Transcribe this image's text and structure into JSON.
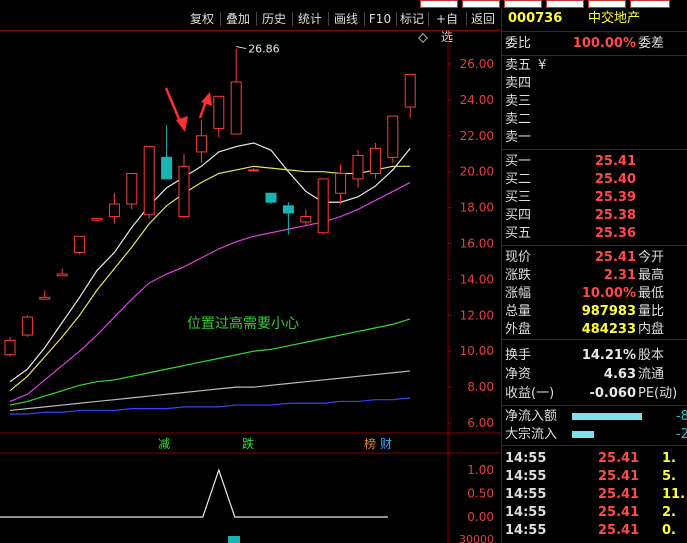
{
  "toolbar": {
    "items": [
      "复权",
      "叠加",
      "历史",
      "统计",
      "画线",
      "F10",
      "标记",
      "+自选",
      "返回"
    ]
  },
  "stock": {
    "code": "000736",
    "name": "中交地产"
  },
  "weibi": {
    "label": "委比",
    "value": "100.00%",
    "right": "委差"
  },
  "sell": [
    {
      "label": "卖五",
      "price": "¥"
    },
    {
      "label": "卖四",
      "price": ""
    },
    {
      "label": "卖三",
      "price": ""
    },
    {
      "label": "卖二",
      "price": ""
    },
    {
      "label": "卖一",
      "price": ""
    }
  ],
  "buy": [
    {
      "label": "买一",
      "price": "25.41"
    },
    {
      "label": "买二",
      "price": "25.40"
    },
    {
      "label": "买三",
      "price": "25.39"
    },
    {
      "label": "买四",
      "price": "25.38"
    },
    {
      "label": "买五",
      "price": "25.36"
    }
  ],
  "quote": [
    {
      "label": "现价",
      "value": "25.41",
      "right": "今开"
    },
    {
      "label": "涨跌",
      "value": "2.31",
      "right": "最高"
    },
    {
      "label": "涨幅",
      "value": "10.00%",
      "right": "最低"
    },
    {
      "label": "总量",
      "value": "987983",
      "right": "量比"
    },
    {
      "label": "外盘",
      "value": "484233",
      "right": "内盘"
    }
  ],
  "stats": [
    {
      "label": "换手",
      "value": "14.21%",
      "right": "股本"
    },
    {
      "label": "净资",
      "value": "4.63",
      "right": "流通"
    },
    {
      "label": "收益(一)",
      "value": "-0.060",
      "right": "PE(动)"
    }
  ],
  "flow": [
    {
      "label": "净流入额",
      "value": "-8"
    },
    {
      "label": "大宗流入",
      "value": "-2"
    }
  ],
  "ticks": [
    {
      "time": "14:55",
      "price": "25.41",
      "vol": "1."
    },
    {
      "time": "14:55",
      "price": "25.41",
      "vol": "5."
    },
    {
      "time": "14:55",
      "price": "25.41",
      "vol": "11."
    },
    {
      "time": "14:55",
      "price": "25.41",
      "vol": "2."
    },
    {
      "time": "14:55",
      "price": "25.41",
      "vol": "0."
    }
  ],
  "chart": {
    "peak_label": "26.86",
    "annotation": "位置过高需要小心",
    "markers": [
      "减",
      "跌",
      "榜",
      "财"
    ],
    "sub_axis": [
      "1.00",
      "0.50",
      "0.00"
    ],
    "bottom_axis": "30000"
  },
  "chart_data": {
    "type": "candlestick",
    "y_ticks": [
      26,
      24,
      22,
      20,
      18,
      16,
      14,
      12,
      10,
      8,
      6
    ],
    "y_tick_labels": [
      "26.00",
      "24.00",
      "22.00",
      "20.00",
      "18.00",
      "16.00",
      "14.00",
      "12.00",
      "10.00",
      "8.00",
      "6.00"
    ],
    "candles": [
      {
        "o": 9.8,
        "c": 10.6,
        "h": 10.8,
        "l": 9.7
      },
      {
        "o": 10.9,
        "c": 11.9,
        "h": 12.0,
        "l": 10.8
      },
      {
        "o": 12.9,
        "c": 13.0,
        "h": 13.4,
        "l": 12.9
      },
      {
        "o": 14.2,
        "c": 14.3,
        "h": 14.6,
        "l": 14.2
      },
      {
        "o": 15.5,
        "c": 16.4,
        "h": 16.4,
        "l": 15.4
      },
      {
        "o": 17.3,
        "c": 17.4,
        "h": 17.4,
        "l": 17.3
      },
      {
        "o": 17.5,
        "c": 18.2,
        "h": 18.8,
        "l": 17.1
      },
      {
        "o": 18.2,
        "c": 19.9,
        "h": 19.9,
        "l": 17.9
      },
      {
        "o": 17.6,
        "c": 21.4,
        "h": 21.4,
        "l": 17.4
      },
      {
        "o": 20.8,
        "c": 19.6,
        "h": 22.6,
        "l": 19.6
      },
      {
        "o": 17.5,
        "c": 20.3,
        "h": 21.0,
        "l": 17.4
      },
      {
        "o": 21.1,
        "c": 22.0,
        "h": 22.9,
        "l": 20.5
      },
      {
        "o": 22.4,
        "c": 24.2,
        "h": 24.2,
        "l": 21.9
      },
      {
        "o": 22.1,
        "c": 25.0,
        "h": 26.86,
        "l": 22.1
      },
      {
        "o": 20.1,
        "c": 20.1,
        "h": 20.2,
        "l": 20.0
      },
      {
        "o": 18.8,
        "c": 18.3,
        "h": 18.8,
        "l": 18.2
      },
      {
        "o": 18.1,
        "c": 17.7,
        "h": 18.3,
        "l": 16.5
      },
      {
        "o": 17.2,
        "c": 17.5,
        "h": 17.9,
        "l": 17.0
      },
      {
        "o": 16.6,
        "c": 19.6,
        "h": 19.6,
        "l": 16.5
      },
      {
        "o": 18.8,
        "c": 19.9,
        "h": 20.4,
        "l": 18.2
      },
      {
        "o": 19.6,
        "c": 20.9,
        "h": 21.2,
        "l": 19.1
      },
      {
        "o": 19.9,
        "c": 21.3,
        "h": 21.6,
        "l": 19.6
      },
      {
        "o": 20.8,
        "c": 23.1,
        "h": 23.1,
        "l": 20.5
      },
      {
        "o": 23.6,
        "c": 25.41,
        "h": 25.41,
        "l": 23.0
      }
    ],
    "ma_white": [
      8.3,
      9.0,
      10.2,
      11.6,
      13.0,
      14.5,
      15.5,
      16.9,
      18.1,
      19.1,
      19.7,
      20.3,
      21.1,
      21.4,
      21.6,
      21.2,
      20.0,
      18.9,
      18.3,
      18.3,
      18.6,
      19.2,
      20.1,
      21.3
    ],
    "ma_yellow": [
      7.8,
      8.6,
      9.7,
      10.8,
      12.0,
      13.4,
      14.6,
      15.8,
      17.1,
      18.1,
      18.8,
      19.4,
      19.9,
      20.1,
      20.3,
      20.2,
      20.1,
      20.0,
      20.0,
      19.9,
      19.9,
      20.1,
      20.3,
      20.3
    ],
    "ma_magenta": [
      7.2,
      7.6,
      8.4,
      9.2,
      10.0,
      10.9,
      11.9,
      12.9,
      13.8,
      14.3,
      14.7,
      15.2,
      15.7,
      16.1,
      16.4,
      16.6,
      16.8,
      17.0,
      17.2,
      17.5,
      17.9,
      18.4,
      18.9,
      19.4
    ],
    "ma_green": [
      7.0,
      7.2,
      7.5,
      7.8,
      8.1,
      8.3,
      8.4,
      8.6,
      8.8,
      9.0,
      9.2,
      9.4,
      9.6,
      9.8,
      10.0,
      10.1,
      10.3,
      10.5,
      10.7,
      10.9,
      11.1,
      11.3,
      11.5,
      11.8
    ],
    "ma_gray": [
      6.7,
      6.8,
      6.9,
      7.0,
      7.1,
      7.2,
      7.3,
      7.4,
      7.5,
      7.6,
      7.7,
      7.8,
      7.9,
      8.0,
      8.0,
      8.1,
      8.2,
      8.3,
      8.4,
      8.5,
      8.6,
      8.7,
      8.8,
      8.9
    ],
    "ma_blue": [
      6.5,
      6.5,
      6.6,
      6.6,
      6.7,
      6.7,
      6.7,
      6.8,
      6.8,
      6.8,
      6.9,
      6.9,
      6.9,
      7.0,
      7.0,
      7.0,
      7.1,
      7.1,
      7.1,
      7.2,
      7.2,
      7.3,
      7.3,
      7.4
    ],
    "sub_series": [
      0,
      0,
      0,
      0,
      0,
      0,
      0,
      0,
      0,
      0,
      0,
      0,
      1,
      0,
      0,
      0,
      0,
      0,
      0,
      0,
      0,
      0,
      0,
      0
    ]
  },
  "colors": {
    "up": "#ff3b3b",
    "down": "#19b4b4",
    "white": "#e8e8e8",
    "yellow": "#e6e65c",
    "magenta": "#e040e0",
    "green": "#33dd33",
    "gray": "#bbbbbb",
    "blue": "#3344ff",
    "grid": "#8b0000"
  }
}
